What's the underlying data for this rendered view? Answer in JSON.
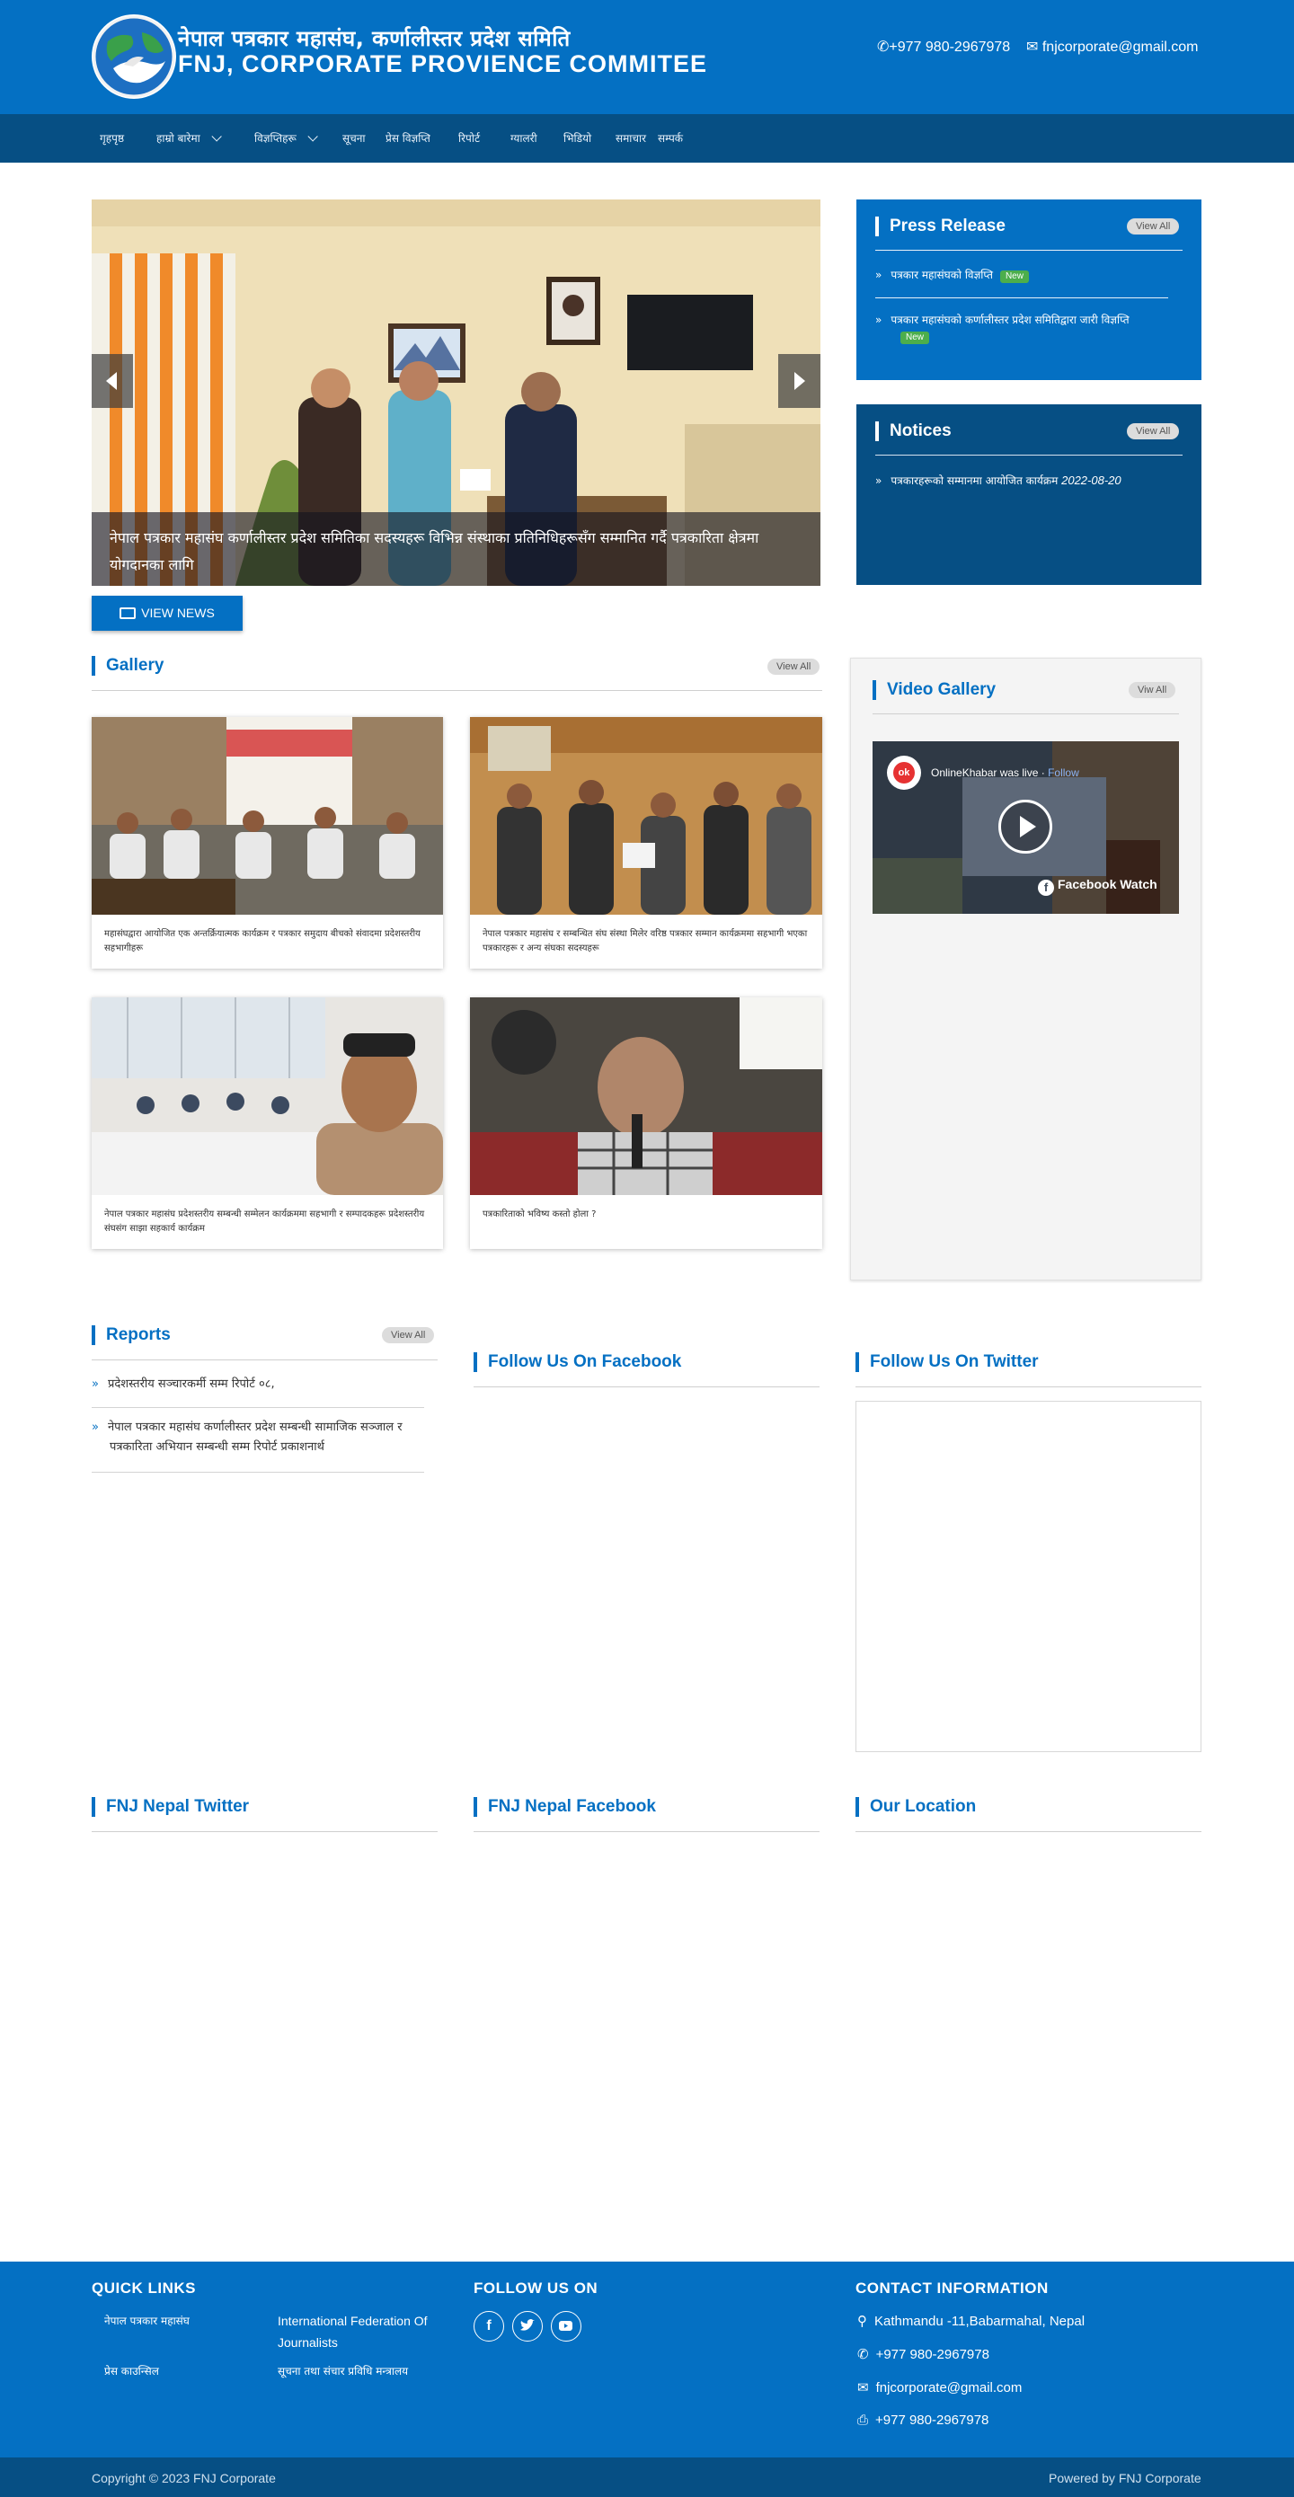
{
  "header": {
    "org_name_np": "नेपाल पत्रकार महासंघ, कर्णालीस्तर प्रदेश समिति",
    "org_name_en": "FNJ, CORPORATE PROVIENCE COMMITEE",
    "phone": "+977 980-2967978",
    "email": "fnjcorporate@gmail.com"
  },
  "nav": {
    "items": [
      {
        "label": "गृहपृष्ठ"
      },
      {
        "label": "हाम्रो बारेमा"
      },
      {
        "label": "विज्ञप्तिहरू"
      },
      {
        "label": "सूचना"
      },
      {
        "label": "प्रेस विज्ञप्ति"
      },
      {
        "label": "रिपोर्ट"
      },
      {
        "label": "ग्यालरी"
      },
      {
        "label": "भिडियो"
      },
      {
        "label": "समाचार"
      },
      {
        "label": "सम्पर्क"
      }
    ]
  },
  "slider": {
    "caption": "नेपाल पत्रकार महासंघ कर्णालीस्तर प्रदेश समितिका सदस्यहरू विभिन्न संस्थाका प्रतिनिधिहरूसँग सम्मानित गर्दै पत्रकारिता क्षेत्रमा योगदानका लागि",
    "view_news_label": "VIEW NEWS"
  },
  "press_release": {
    "title": "Press Release",
    "view_all": "View All",
    "items": [
      {
        "text": "पत्रकार महासंघको विज्ञप्ति",
        "badge": "New"
      },
      {
        "text": "पत्रकार महासंघको कर्णालीस्तर प्रदेश समितिद्वारा जारी विज्ञप्ति",
        "badge": "New"
      }
    ]
  },
  "notices": {
    "title": "Notices",
    "view_all": "View All",
    "items": [
      {
        "text": "पत्रकारहरूको सम्मानमा आयोजित कार्यक्रम",
        "date": "2022-08-20"
      }
    ]
  },
  "gallery": {
    "title": "Gallery",
    "view_all": "View All",
    "items": [
      {
        "caption": "महासंघद्वारा आयोजित एक अन्तर्क्रियात्मक कार्यक्रम र पत्रकार समुदाय बीचको संवादमा प्रदेशस्तरीय सहभागीहरू"
      },
      {
        "caption": "नेपाल पत्रकार महासंघ र सम्बन्धित संघ संस्था मिलेर वरिष्ठ पत्रकार सम्मान कार्यक्रममा सहभागी भएका पत्रकारहरू र अन्य संघका सदस्यहरू"
      },
      {
        "caption": "नेपाल पत्रकार महासंघ प्रदेशस्तरीय सम्बन्धी सम्मेलन कार्यक्रममा सहभागी र सम्पादकहरू प्रदेशस्तरीय संघसंग साझा सहकार्य कार्यक्रम"
      },
      {
        "caption": "पत्रकारिताको भविष्य कस्तो होला ?"
      }
    ]
  },
  "video_gallery": {
    "title": "Video Gallery",
    "view_all": "Viw All",
    "channel": "OnlineKhabar was live",
    "follow": "Follow",
    "watch_label": "Facebook Watch"
  },
  "reports": {
    "title": "Reports",
    "view_all": "View All",
    "items": [
      {
        "text": "प्रदेशस्तरीय सञ्चारकर्मी सम्म रिपोर्ट ०८,"
      },
      {
        "text": "नेपाल पत्रकार महासंघ कर्णालीस्तर प्रदेश सम्बन्धी सामाजिक सञ्जाल र पत्रकारिता अभियान सम्बन्धी सम्म रिपोर्ट प्रकाशनार्थ"
      }
    ]
  },
  "follow_facebook": {
    "title": "Follow Us On Facebook"
  },
  "follow_twitter": {
    "title": "Follow Us On Twitter"
  },
  "fnj_twitter": {
    "title": "FNJ Nepal Twitter"
  },
  "fnj_facebook": {
    "title": "FNJ Nepal Facebook"
  },
  "our_location": {
    "title": "Our Location"
  },
  "footer": {
    "quick_links_title": "QUICK LINKS",
    "quick_links": [
      {
        "label": "नेपाल पत्रकार महासंघ",
        "np": true
      },
      {
        "label": "International Federation Of Journalists",
        "np": false
      },
      {
        "label": "प्रेस काउन्सिल",
        "np": true
      },
      {
        "label": "सूचना तथा संचार प्रविधि मन्त्रालय",
        "np": true
      }
    ],
    "follow_title": "FOLLOW US ON",
    "contact_title": "CONTACT INFORMATION",
    "address": "Kathmandu -11,Babarmahal, Nepal",
    "phone": "+977 980-2967978",
    "email": "fnjcorporate@gmail.com",
    "fax": "+977 980-2967978",
    "copyright": "Copyright © 2023 FNJ Corporate",
    "powered_by": "Powered by FNJ Corporate"
  },
  "colors": {
    "primary": "#0470c3",
    "primary_dark": "#064f84",
    "badge_green": "#4cae4c"
  }
}
